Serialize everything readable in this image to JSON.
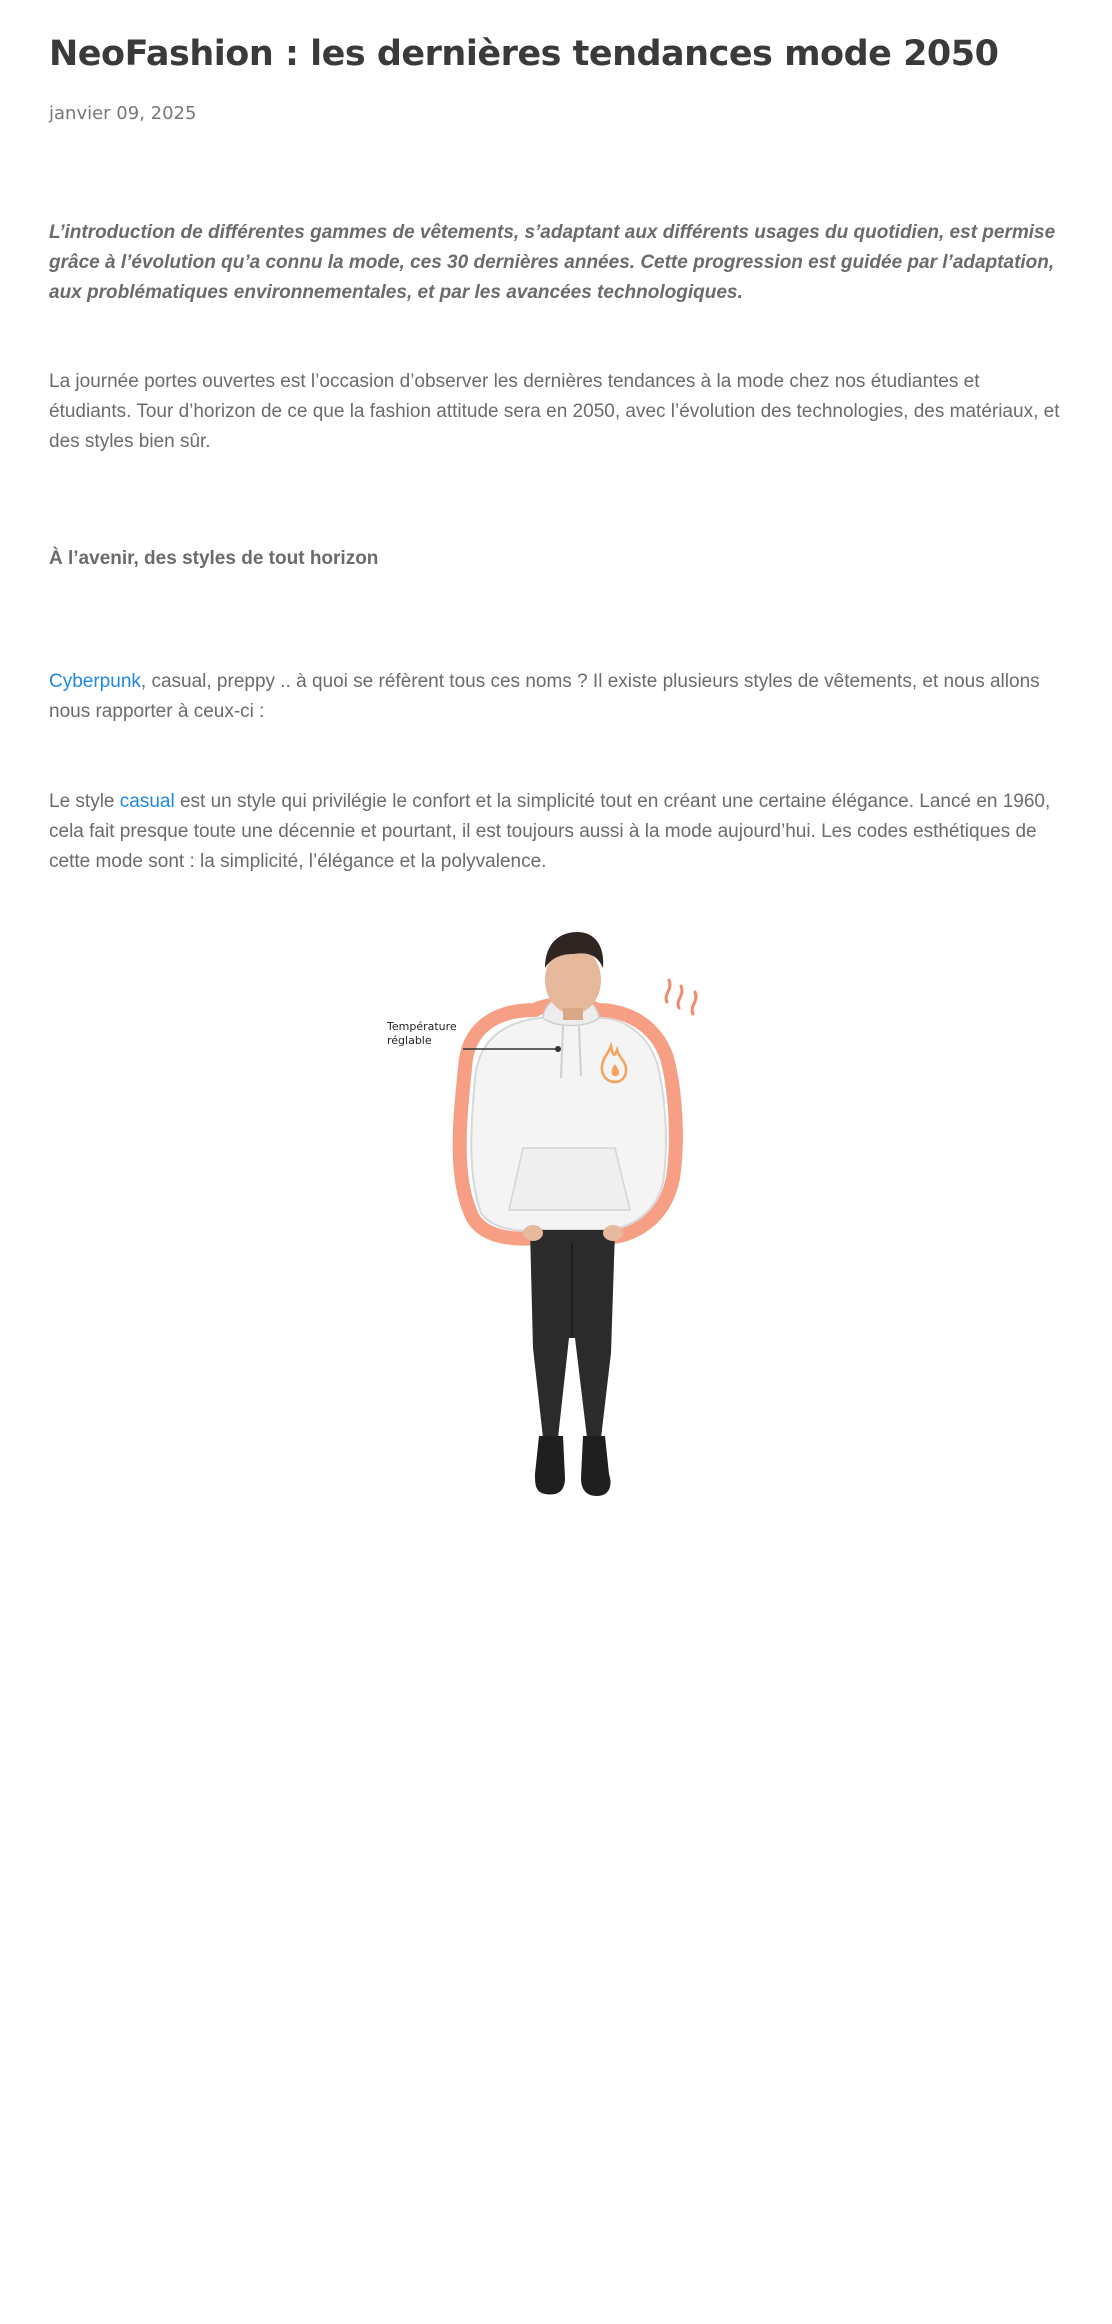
{
  "article": {
    "title": "NeoFashion : les dernières tendances mode 2050",
    "date": "janvier 09, 2025",
    "intro": "L’introduction de différentes gammes de vêtements, s’adaptant aux différents usages du quotidien, est permise grâce à l’évolution qu’a connu la mode, ces 30 dernières années. Cette progression est guidée par l’adaptation, aux problématiques environnementales, et par les avancées technologiques.",
    "paragraph1": "La journée portes ouvertes est l’occasion d’observer les dernières tendances à la mode chez nos étudiantes et étudiants. Tour d’horizon de ce que la fashion attitude sera en 2050, avec l’évolution des technologies, des matériaux, et des styles bien sûr.",
    "heading": "À l’avenir, des styles de tout horizon",
    "paragraph2_link": "Cyberpunk",
    "paragraph2_text": ", casual, preppy .. à quoi se réfèrent tous ces noms ? Il existe plusieurs styles de vêtements, et nous allons nous rapporter à ceux-ci :",
    "paragraph3_prefix": "Le style ",
    "paragraph3_link": "casual",
    "paragraph3_text": " est un style qui privilégie le confort et la simplicité tout en créant une certaine élégance. Lancé en 1960, cela fait presque toute une décennie et pourtant, il est toujours aussi à la mode aujourd’hui. Les codes esthétiques de cette mode sont : la simplicité, l’élégance et la polyvalence."
  },
  "figure": {
    "callout_line1": "Température",
    "callout_line2": "réglable",
    "glow_color": "#f79a7e",
    "hoodie_color": "#f4f4f4",
    "jeans_color": "#2b2b2b",
    "flame_color": "#f5a25a",
    "icon": "flame-icon"
  }
}
